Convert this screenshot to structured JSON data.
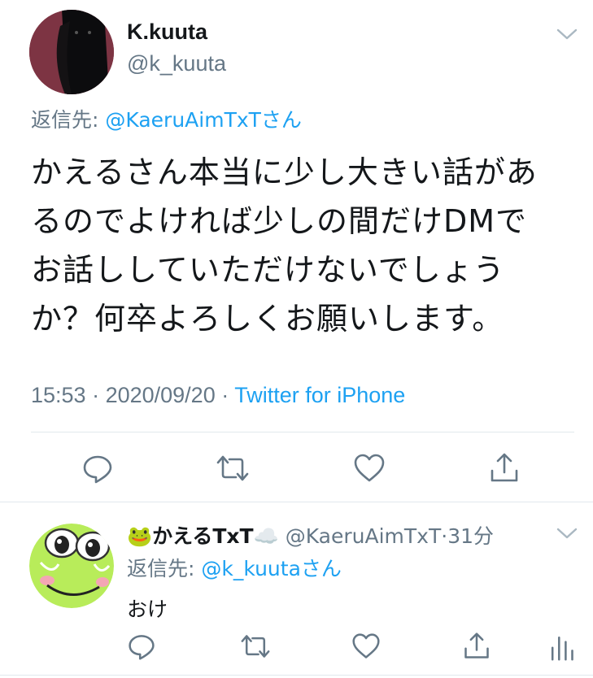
{
  "main_tweet": {
    "display_name": "K.kuuta",
    "handle": "@k_kuuta",
    "reply_prefix": "返信先:",
    "reply_to": "@KaeruAimTxT",
    "reply_suffix": "さん",
    "lines": [
      "かえるさん本当に少し大きい話があ",
      "るのでよければ少しの間だけDMで",
      "お話ししていただけないでしょう",
      "か？何卒よろしくお願いします。"
    ],
    "time": "15:53",
    "date": "2020/09/20",
    "source": "Twitter for iPhone",
    "sep": " · "
  },
  "reply_tweet": {
    "display_name": "🐸かえるTxT☁️",
    "handle": "@KaeruAimTxT",
    "age": "31分",
    "sep": "·",
    "reply_prefix": "返信先:",
    "reply_to": "@k_kuuta",
    "reply_suffix": "さん",
    "text": "おけ"
  },
  "icons": {
    "main": [
      "chevron-down-icon",
      "reply-icon",
      "retweet-icon",
      "like-icon",
      "share-icon"
    ],
    "reply": [
      "chevron-down-icon",
      "reply-icon",
      "retweet-icon",
      "like-icon",
      "share-icon",
      "analytics-icon"
    ]
  },
  "colors": {
    "link": "#1da1f2",
    "muted": "#657786",
    "divider": "#e1e8ed"
  }
}
